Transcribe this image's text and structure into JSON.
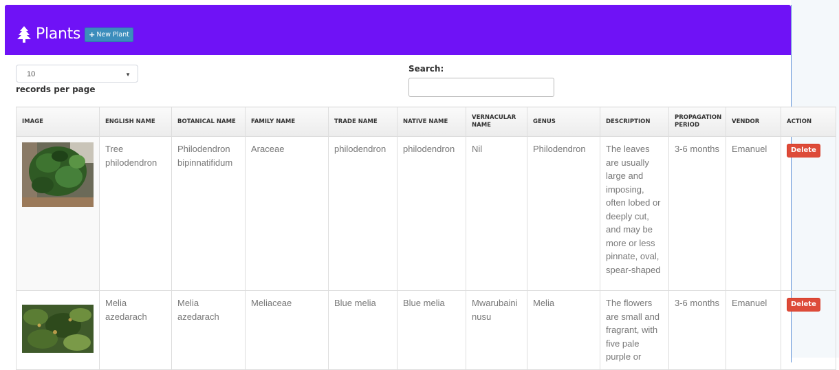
{
  "header": {
    "title": "Plants",
    "new_button_label": "New Plant",
    "accent_color": "#6f12f6"
  },
  "controls": {
    "length_value": "10",
    "length_label": "records per page",
    "search_label": "Search:",
    "search_value": ""
  },
  "table": {
    "columns": [
      "Image",
      "English Name",
      "Botanical Name",
      "Family Name",
      "Trade Name",
      "Native Name",
      "Vernacular Name",
      "Genus",
      "Description",
      "Propagation Period",
      "Vendor",
      "Action"
    ],
    "rows": [
      {
        "english_name": "Tree philodendron",
        "botanical_name": "Philodendron bipinnatifidum",
        "family_name": "Araceae",
        "trade_name": "philodendron",
        "native_name": "philodendron",
        "vernacular_name": "Nil",
        "genus": "Philodendron",
        "description": "The leaves are usually large and imposing, often lobed or deeply cut, and may be more or less pinnate, oval, spear-shaped",
        "propagation_period": "3-6 months",
        "vendor": "Emanuel",
        "action_label": "Delete"
      },
      {
        "english_name": "Melia azedarach",
        "botanical_name": "Melia azedarach",
        "family_name": "Meliaceae",
        "trade_name": "Blue melia",
        "native_name": "Blue melia",
        "vernacular_name": "Mwarubaini nusu",
        "genus": "Melia",
        "description": "The flowers are small and fragrant, with five pale purple or",
        "propagation_period": "3-6 months",
        "vendor": "Emanuel",
        "action_label": "Delete"
      }
    ]
  }
}
